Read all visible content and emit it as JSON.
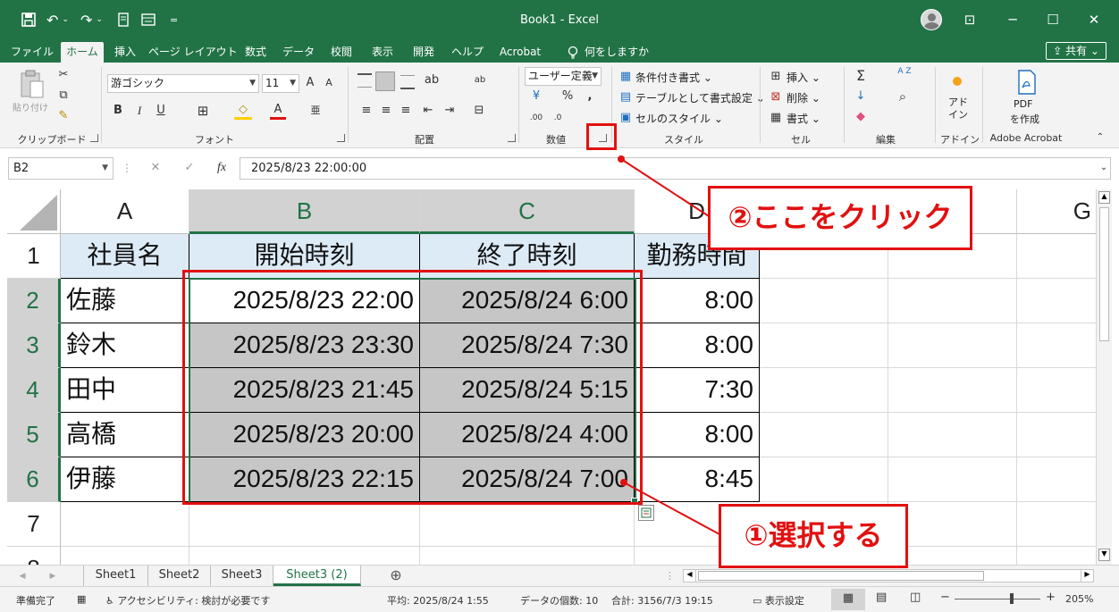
{
  "titlebar": {
    "title": "Book1 - Excel",
    "qat": {
      "save_icon": "save-icon",
      "undo": "↶",
      "redo": "↷",
      "customize": "="
    },
    "window": {
      "ribbon_display": "⊡",
      "minimize": "─",
      "maximize": "☐",
      "close": "✕"
    }
  },
  "tabs": [
    "ファイル",
    "ホーム",
    "挿入",
    "ページ レイアウト",
    "数式",
    "データ",
    "校閲",
    "表示",
    "開発",
    "ヘルプ",
    "Acrobat",
    "何をしますか"
  ],
  "share_label": "共有",
  "ribbon": {
    "clipboard": {
      "label": "クリップボード",
      "paste": "貼り付け"
    },
    "font": {
      "label": "フォント",
      "font_name": "游ゴシック",
      "font_size": "11",
      "grow": "A",
      "shrink": "A",
      "bold": "B",
      "italic": "I",
      "underline": "U",
      "border": "⊞",
      "fill": "◇",
      "font_color": "A",
      "phonetic": "亜"
    },
    "alignment": {
      "label": "配置",
      "wrap": "ab",
      "orient": "ab"
    },
    "number": {
      "label": "数値",
      "format": "ユーザー定義",
      "percent": "%",
      "comma": ",",
      "currency": "¥",
      "inc": ".00",
      "dec": ".0"
    },
    "styles": {
      "label": "スタイル",
      "cond": "条件付き書式",
      "table": "テーブルとして書式設定",
      "cell": "セルのスタイル"
    },
    "cells": {
      "label": "セル",
      "insert": "挿入",
      "delete": "削除",
      "format": "書式"
    },
    "editing": {
      "label": "編集",
      "sum": "Σ",
      "fill": "↓",
      "clear": "◆",
      "sort": "A Z",
      "find": "⌕"
    },
    "addins": {
      "label": "アドイン",
      "addin": "アド\nイン"
    },
    "acrobat": {
      "label": "Adobe Acrobat",
      "pdf": "PDF",
      "create": "を作成"
    }
  },
  "formula_bar": {
    "name_box": "B2",
    "cancel": "✕",
    "enter": "✓",
    "fx": "fx",
    "value": "2025/8/23  22:00:00"
  },
  "columns": [
    "A",
    "B",
    "C",
    "D",
    "",
    "",
    "",
    "G"
  ],
  "rows": [
    "1",
    "2",
    "3",
    "4",
    "5",
    "6",
    "7",
    "8"
  ],
  "table": {
    "headers": [
      "社員名",
      "開始時刻",
      "終了時刻",
      "勤務時間"
    ],
    "data": [
      [
        "佐藤",
        "2025/8/23 22:00",
        "2025/8/24 6:00",
        "8:00"
      ],
      [
        "鈴木",
        "2025/8/23 23:30",
        "2025/8/24 7:30",
        "8:00"
      ],
      [
        "田中",
        "2025/8/23 21:45",
        "2025/8/24 5:15",
        "7:30"
      ],
      [
        "高橋",
        "2025/8/23 20:00",
        "2025/8/24 4:00",
        "8:00"
      ],
      [
        "伊藤",
        "2025/8/23 22:15",
        "2025/8/24 7:00",
        "8:45"
      ]
    ]
  },
  "sheets": [
    "Sheet1",
    "Sheet2",
    "Sheet3",
    "Sheet3 (2)"
  ],
  "add_sheet": "⊕",
  "status": {
    "ready": "準備完了",
    "accessibility": "アクセシビリティ: 検討が必要です",
    "average": "平均: 2025/8/24 1:55",
    "count": "データの個数: 10",
    "sum": "合計: 3156/7/3 19:15",
    "display_settings": "表示設定",
    "zoom": "205%",
    "zoom_minus": "−",
    "zoom_plus": "+"
  },
  "annotations": {
    "select": "①選択する",
    "click_here": "②ここをクリック"
  },
  "colors": {
    "excel_green": "#217346",
    "annotation_red": "#e21010",
    "header_fill": "#ddebf7",
    "selection": "#c6c6c6"
  }
}
